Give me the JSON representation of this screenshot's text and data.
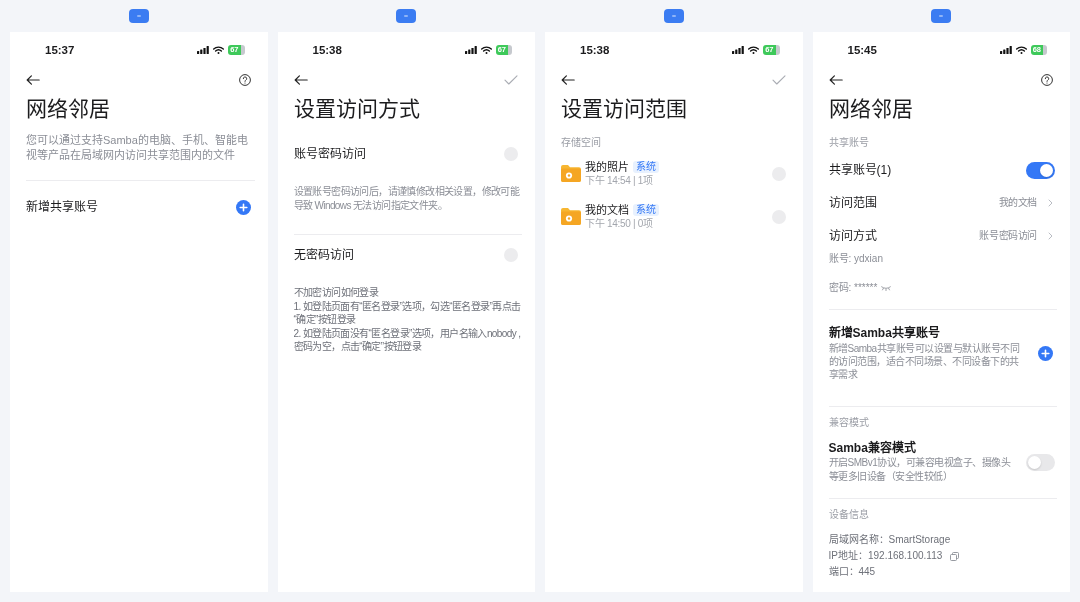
{
  "screens": [
    {
      "status_bar": {
        "time": "15:37",
        "battery": "67"
      },
      "nav": {
        "help": true
      },
      "title": "网络邻居",
      "blocks": [
        {
          "kind": "text",
          "text": "您可以通过支持Samba的电脑、手机、智能电视等产品在局域网内访问共享范围内的文件"
        },
        {
          "kind": "divider"
        },
        {
          "kind": "add_row",
          "label": "新增共享账号"
        }
      ]
    },
    {
      "status_bar": {
        "time": "15:38",
        "battery": "67"
      },
      "nav": {
        "confirm": true
      },
      "title": "设置访问方式",
      "blocks": [
        {
          "kind": "option",
          "label": "账号密码访问",
          "selected": false,
          "notes": [
            "设置账号密码访问后，请谨慎修改相关设置，修改可能导致 Windows 无法访问指定文件夹。"
          ]
        },
        {
          "kind": "divider"
        },
        {
          "kind": "option",
          "label": "无密码访问",
          "selected": false,
          "notes": [
            "不加密访问如何登录",
            "1. 如登陆页面有“匿名登录”选项，勾选“匿名登录”再点击“确定”按钮登录",
            "2. 如登陆页面没有“匿名登录”选项，用户名输入nobody ,密码为空，点击“确定”按钮登录"
          ]
        }
      ]
    },
    {
      "status_bar": {
        "time": "15:38",
        "battery": "67"
      },
      "nav": {
        "confirm": true
      },
      "title": "设置访问范围",
      "blocks": [
        {
          "kind": "label",
          "text": "存储空间"
        },
        {
          "kind": "folder",
          "name": "我的照片",
          "badge": "系统",
          "meta": "下午 14:54 | 1项",
          "selected": false
        },
        {
          "kind": "folder",
          "name": "我的文档",
          "badge": "系统",
          "meta": "下午 14:50 | 0项",
          "selected": false
        }
      ]
    },
    {
      "status_bar": {
        "time": "15:45",
        "battery": "68"
      },
      "nav": {
        "help": true
      },
      "title": "网络邻居",
      "blocks": [
        {
          "kind": "label",
          "text": "共享账号"
        },
        {
          "kind": "switch",
          "label": "共享账号(1)",
          "on": true
        },
        {
          "kind": "link",
          "label": "访问范围",
          "value": "我的文档"
        },
        {
          "kind": "link",
          "label": "访问方式",
          "value": "账号密码访问"
        },
        {
          "kind": "detail",
          "text": "账号: ydxian"
        },
        {
          "kind": "password",
          "text": "密码: ******"
        },
        {
          "kind": "divider"
        },
        {
          "kind": "add_row",
          "label": "新增Samba共享账号",
          "description": "新增Samba共享账号可以设置与默认账号不同的访问范围，适合不同场景、不同设备下的共享需求"
        },
        {
          "kind": "divider"
        },
        {
          "kind": "label",
          "text": "兼容模式"
        },
        {
          "kind": "switch",
          "label": "Samba兼容模式",
          "description": "开启SMBv1协议，可兼容电视盒子、摄像头等更多旧设备（安全性较低）",
          "on": false
        },
        {
          "kind": "divider"
        },
        {
          "kind": "label",
          "text": "设备信息"
        },
        {
          "kind": "info",
          "text": "局域网名称：SmartStorage"
        },
        {
          "kind": "info",
          "text": "IP地址：192.168.100.113",
          "copyable": true
        },
        {
          "kind": "info",
          "text": "端口：445"
        }
      ]
    }
  ]
}
